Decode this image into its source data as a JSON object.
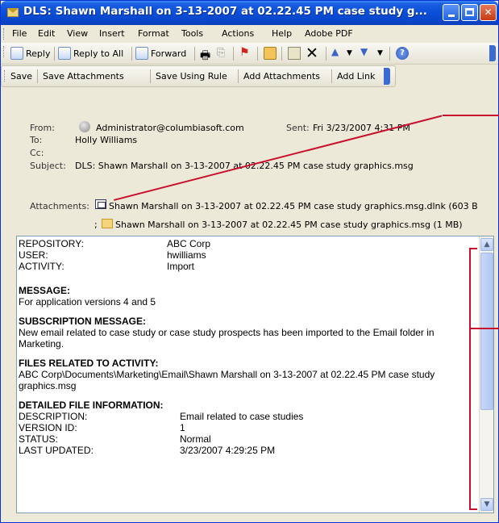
{
  "window": {
    "title": "DLS: Shawn Marshall on 3-13-2007 at 02.22.45 PM case study g...",
    "buttons": {
      "minimize": "minimize",
      "maximize": "maximize",
      "close": "close"
    }
  },
  "menubar": {
    "items": [
      "File",
      "Edit",
      "View",
      "Insert",
      "Format",
      "Tools",
      "Actions",
      "Help",
      "Adobe PDF"
    ]
  },
  "toolbar1": {
    "reply": "Reply",
    "reply_all": "Reply to All",
    "forward": "Forward"
  },
  "toolbar2": {
    "items": [
      "Save",
      "Save Attachments",
      "Save Using Rule",
      "Add Attachments",
      "Add Link"
    ]
  },
  "header": {
    "from_label": "From:",
    "from_value": "Administrator@columbiasoft.com",
    "sent_label": "Sent:",
    "sent_value": "Fri 3/23/2007 4:31 PM",
    "to_label": "To:",
    "to_value": "Holly Williams",
    "cc_label": "Cc:",
    "cc_value": "",
    "subject_label": "Subject:",
    "subject_value": "DLS: Shawn Marshall on 3-13-2007 at 02.22.45 PM case study graphics.msg",
    "attachments_label": "Attachments:",
    "attachment1": "Shawn Marshall on 3-13-2007 at 02.22.45 PM case study graphics.msg.dlnk (603 B",
    "attachment_sep": ";",
    "attachment2": "Shawn Marshall on 3-13-2007 at 02.22.45 PM case study graphics.msg (1 MB)"
  },
  "body": {
    "repository_label": "REPOSITORY:",
    "repository_value": "ABC Corp",
    "user_label": "USER:",
    "user_value": "hwilliams",
    "activity_label": "ACTIVITY:",
    "activity_value": "Import",
    "message_title": "MESSAGE:",
    "message_text": "For application versions 4 and 5",
    "subscription_title": "SUBSCRIPTION MESSAGE:",
    "subscription_text": "New email related to case study or case study prospects has been imported to the Email folder in Marketing.",
    "files_title": "FILES RELATED TO ACTIVITY:",
    "files_text": "ABC Corp\\Documents\\Marketing\\Email\\Shawn Marshall on 3-13-2007 at 02.22.45 PM case study graphics.msg",
    "detailed_title": "DETAILED FILE INFORMATION:",
    "description_label": "DESCRIPTION:",
    "description_value": "Email related to case studies",
    "version_label": "VERSION ID:",
    "version_value": "1",
    "status_label": "STATUS:",
    "status_value": "Normal",
    "updated_label": "LAST UPDATED:",
    "updated_value": "3/23/2007 4:29:25 PM"
  },
  "colors": {
    "titlebar": "#0a4ed8",
    "annotation": "#c8102e",
    "background": "#ece9d8"
  }
}
